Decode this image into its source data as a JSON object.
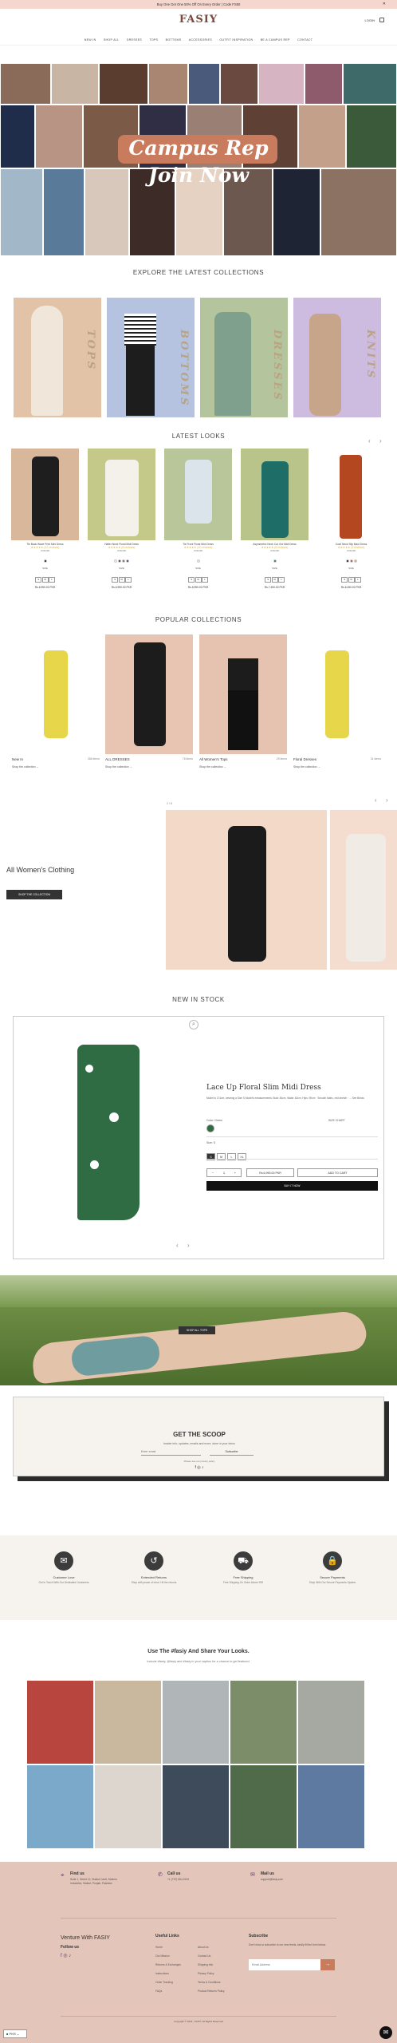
{
  "promo": "Buy One Get One 50% Off On Every Order | Code FS50",
  "brand": "FASIY",
  "login_label": "LOGIN",
  "nav": [
    "NEW IN",
    "SHOP ALL",
    "DRESSES",
    "TOPS",
    "BOTTOMS",
    "ACCESSORIES",
    "OUTFIT INSPIRATION",
    "BE A CAMPUS REP",
    "CONTACT"
  ],
  "hero": {
    "line1": "Campus Rep",
    "line2": "Join Now"
  },
  "explore": {
    "title": "EXPLORE THE LATEST COLLECTIONS",
    "cats": [
      "TOPS",
      "BOTTOMS",
      "DRESSES",
      "KNITS"
    ]
  },
  "latest": {
    "title": "LATEST LOOKS",
    "products": [
      {
        "name": "Tie Back Wave Print Mini Dress",
        "reviews": "(12 reviews)",
        "color_label": "COLOR",
        "size_label": "SIZE",
        "sizes": [
          "S",
          "M",
          "L"
        ],
        "price": "Rs.6,990.00 PKR"
      },
      {
        "name": "Halter Neck Floral Midi Dress",
        "reviews": "(8 reviews)",
        "color_label": "COLOR",
        "size_label": "SIZE",
        "sizes": [
          "S",
          "M",
          "L"
        ],
        "price": "Rs.6,990.00 PKR"
      },
      {
        "name": "Tie Front Floral Mini Dress",
        "reviews": "(10 reviews)",
        "color_label": "COLOR",
        "size_label": "SIZE",
        "sizes": [
          "S",
          "M",
          "L"
        ],
        "price": "Rs.5,990.00 PKR"
      },
      {
        "name": "Asymmetric Neck Cut Out Midi Dress",
        "reviews": "(6 reviews)",
        "color_label": "COLOR",
        "size_label": "SIZE",
        "sizes": [
          "S",
          "M",
          "L"
        ],
        "price": "Rs.7,490.00 PKR"
      },
      {
        "name": "Cowl Neck Slip Maxi Dress",
        "reviews": "(9 reviews)",
        "color_label": "COLOR",
        "size_label": "SIZE",
        "sizes": [
          "S",
          "M",
          "L"
        ],
        "price": "Rs.6,490.00 PKR"
      }
    ]
  },
  "popular": {
    "title": "POPULAR COLLECTIONS",
    "items": [
      {
        "name": "New In",
        "count": "286 items",
        "shop": "Shop the collection"
      },
      {
        "name": "ALL DRESSES",
        "count": "76 items",
        "shop": "Shop the collection"
      },
      {
        "name": "All Women's Tops",
        "count": "29 items",
        "shop": "Shop the collection"
      },
      {
        "name": "Floral Dresses",
        "count": "31 items",
        "shop": "Shop the collection"
      }
    ]
  },
  "women": {
    "counter": "2 / 8",
    "title": "All Women's Clothing",
    "button": "SHOP THE COLLECTION"
  },
  "new_in": {
    "title": "NEW IN STOCK",
    "product": {
      "title": "Lace Up Floral Slim Midi Dress",
      "desc": "Model is 174cm, wearing a Size S Model's measurements: Bust: 84cm, Waist: 62cm, Hips: 90cm · Smooth fabric, mid stretch · ... See Below",
      "color_label": "Color: Green",
      "size_label": "Size: S",
      "size_chart": "SIZE CHART",
      "sizes": [
        "S",
        "M",
        "L",
        "XL"
      ],
      "qty": "1",
      "price": "Rs.6,990.00 PKR",
      "add_label": "ADD TO CART",
      "buy_label": "BUY IT NOW"
    }
  },
  "lawn": {
    "button": "SHOP ALL TOPS"
  },
  "scoop": {
    "title": "GET THE SCOOP",
    "sub": "Insider info, updates, emails and more, done in your inbox",
    "placeholder": "Enter email",
    "button": "Subscribe",
    "privacy": "Please see our privacy policy"
  },
  "features": [
    {
      "icon": "chat-icon",
      "glyph": "✉",
      "title": "Customer Love",
      "desc": "Get In Touch With Our Dedicated Customers"
    },
    {
      "icon": "return-icon",
      "glyph": "↺",
      "title": "Extended Returns",
      "desc": "Shop with peace of mind. Hit the returns"
    },
    {
      "icon": "truck-icon",
      "glyph": "⛟",
      "title": "Free Shipping",
      "desc": "Free Shipping On Order Above 999"
    },
    {
      "icon": "lock-icon",
      "glyph": "🔒",
      "title": "Secure Payments",
      "desc": "Shop With Our Secure Payments System"
    }
  ],
  "ugc": {
    "title": "Use The #fasiy And Share Your Looks.",
    "sub": "Include #fasiy, @fasiy and #fasiy in your caption for a chance to get featured."
  },
  "footer": {
    "contacts": [
      {
        "title": "Find us",
        "text": "Suite 1, Street 12, Sialkot Cantt, Modern Industries, Sialkot, Punjab, Pakistan"
      },
      {
        "title": "Call us",
        "text": "+1 (737) 664-0120"
      },
      {
        "title": "Mail us",
        "text": "support@fasiy.com"
      }
    ],
    "venture": "Venture With FASIY",
    "follow": "Follow us",
    "links_title": "Useful Links",
    "links_col1": [
      "Home",
      "Our Mission",
      "Returns & Exchanges",
      "Instructions",
      "Order Tracking",
      "FAQs"
    ],
    "links_col2": [
      "About Us",
      "Contact Us",
      "Shipping Info",
      "Privacy Policy",
      "Terms & Conditions",
      "Product Returns Policy"
    ],
    "subscribe_title": "Subscribe",
    "subscribe_text": "Don't miss to subscribe to our new feeds, kindly fill the form below.",
    "email_placeholder": "Email Address",
    "copyright": "Copyright © 2024 , FASIY. All Rights Reserved",
    "currency": "PKR"
  },
  "colors": {
    "accent": "#c97c5d",
    "footer_bg": "#e4c5b9",
    "promo_bg": "#f6d7ce",
    "dark": "#333333"
  }
}
